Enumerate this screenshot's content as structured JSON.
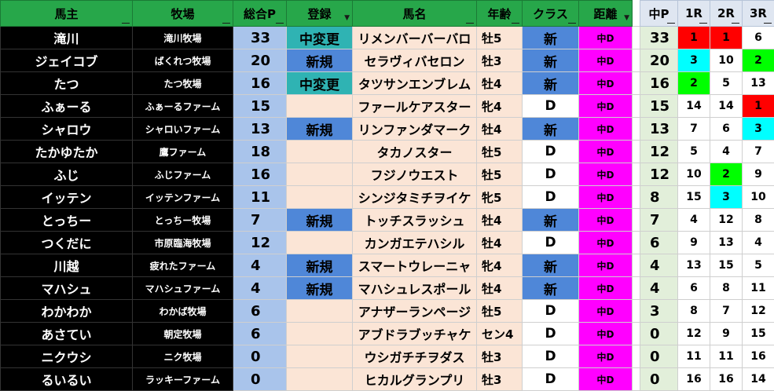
{
  "headers": {
    "owner": "馬主",
    "farm": "牧場",
    "total_points": "総合P",
    "registration": "登録",
    "horse_name": "馬名",
    "age": "年齢",
    "class": "クラス",
    "distance": "距離",
    "mid_points": "中P",
    "race1": "1R",
    "race2": "2R",
    "race3": "3R"
  },
  "filter_glyph": "▼",
  "colors": {
    "header_green": "#27a74a",
    "owner_black": "#000000",
    "total_blue": "#a9c4eb",
    "reg_teal": "#2fb3b3",
    "reg_blue": "#4f87d8",
    "peach": "#fbe5d6",
    "magenta": "#ff00ff",
    "midp_green": "#e2efda",
    "rank_red": "#ff0000",
    "rank_cyan": "#00ffff",
    "rank_green": "#00ff00"
  },
  "rows": [
    {
      "owner": "滝川",
      "farm": "滝川牧場",
      "total": "33",
      "registration": "中変更",
      "reg_type": "mid",
      "horse": "リメンバーバーバロ",
      "age": "牡5",
      "class": "新",
      "class_type": "new",
      "distance": "中D",
      "mid_p": "33",
      "r1": "1",
      "r1_color": "red",
      "r2": "1",
      "r2_color": "red",
      "r3": "6",
      "r3_color": ""
    },
    {
      "owner": "ジェイコブ",
      "farm": "ばくれつ牧場",
      "total": "20",
      "registration": "新規",
      "reg_type": "new",
      "horse": "セラヴィバセロン",
      "age": "牡3",
      "class": "新",
      "class_type": "new",
      "distance": "中D",
      "mid_p": "20",
      "r1": "3",
      "r1_color": "cyan",
      "r2": "10",
      "r2_color": "",
      "r3": "2",
      "r3_color": "green"
    },
    {
      "owner": "たつ",
      "farm": "たつ牧場",
      "total": "16",
      "registration": "中変更",
      "reg_type": "mid",
      "horse": "タツサンエンブレム",
      "age": "牡4",
      "class": "新",
      "class_type": "new",
      "distance": "中D",
      "mid_p": "16",
      "r1": "2",
      "r1_color": "green",
      "r2": "5",
      "r2_color": "",
      "r3": "13",
      "r3_color": ""
    },
    {
      "owner": "ふぁーる",
      "farm": "ふぁーるファーム",
      "total": "15",
      "registration": "",
      "reg_type": "",
      "horse": "ファールケアスター",
      "age": "牝4",
      "class": "D",
      "class_type": "",
      "distance": "中D",
      "mid_p": "15",
      "r1": "14",
      "r1_color": "",
      "r2": "14",
      "r2_color": "",
      "r3": "1",
      "r3_color": "red"
    },
    {
      "owner": "シャロウ",
      "farm": "シャロいファーム",
      "total": "13",
      "registration": "新規",
      "reg_type": "new",
      "horse": "リンファンダマーク",
      "age": "牡4",
      "class": "新",
      "class_type": "new",
      "distance": "中D",
      "mid_p": "13",
      "r1": "7",
      "r1_color": "",
      "r2": "6",
      "r2_color": "",
      "r3": "3",
      "r3_color": "cyan"
    },
    {
      "owner": "たかゆたか",
      "farm": "鷹ファーム",
      "total": "18",
      "registration": "",
      "reg_type": "",
      "horse": "タカノスター",
      "age": "牡5",
      "class": "D",
      "class_type": "",
      "distance": "中D",
      "mid_p": "12",
      "r1": "5",
      "r1_color": "",
      "r2": "4",
      "r2_color": "",
      "r3": "7",
      "r3_color": ""
    },
    {
      "owner": "ふじ",
      "farm": "ふじファーム",
      "total": "16",
      "registration": "",
      "reg_type": "",
      "horse": "フジノウエスト",
      "age": "牡5",
      "class": "D",
      "class_type": "",
      "distance": "中D",
      "mid_p": "12",
      "r1": "10",
      "r1_color": "",
      "r2": "2",
      "r2_color": "green",
      "r3": "9",
      "r3_color": ""
    },
    {
      "owner": "イッテン",
      "farm": "イッテンファーム",
      "total": "11",
      "registration": "",
      "reg_type": "",
      "horse": "シンジタミチヲイケ",
      "age": "牝5",
      "class": "D",
      "class_type": "",
      "distance": "中D",
      "mid_p": "8",
      "r1": "15",
      "r1_color": "",
      "r2": "3",
      "r2_color": "cyan",
      "r3": "10",
      "r3_color": ""
    },
    {
      "owner": "とっちー",
      "farm": "とっちー牧場",
      "total": "7",
      "registration": "新規",
      "reg_type": "new",
      "horse": "トッチスラッシュ",
      "age": "牡4",
      "class": "新",
      "class_type": "new",
      "distance": "中D",
      "mid_p": "7",
      "r1": "4",
      "r1_color": "",
      "r2": "12",
      "r2_color": "",
      "r3": "8",
      "r3_color": ""
    },
    {
      "owner": "つくだに",
      "farm": "市原臨海牧場",
      "total": "12",
      "registration": "",
      "reg_type": "",
      "horse": "カンガエテハシル",
      "age": "牡4",
      "class": "D",
      "class_type": "",
      "distance": "中D",
      "mid_p": "6",
      "r1": "9",
      "r1_color": "",
      "r2": "13",
      "r2_color": "",
      "r3": "4",
      "r3_color": ""
    },
    {
      "owner": "川越",
      "farm": "疲れたファーム",
      "total": "4",
      "registration": "新規",
      "reg_type": "new",
      "horse": "スマートウレーニャ",
      "age": "牝4",
      "class": "新",
      "class_type": "new",
      "distance": "中D",
      "mid_p": "4",
      "r1": "13",
      "r1_color": "",
      "r2": "15",
      "r2_color": "",
      "r3": "5",
      "r3_color": ""
    },
    {
      "owner": "マハシュ",
      "farm": "マハシュファーム",
      "total": "4",
      "registration": "新規",
      "reg_type": "new",
      "horse": "マハシュレスポール",
      "age": "牡4",
      "class": "新",
      "class_type": "new",
      "distance": "中D",
      "mid_p": "4",
      "r1": "6",
      "r1_color": "",
      "r2": "8",
      "r2_color": "",
      "r3": "11",
      "r3_color": ""
    },
    {
      "owner": "わかわか",
      "farm": "わかば牧場",
      "total": "6",
      "registration": "",
      "reg_type": "",
      "horse": "アナザーランページ",
      "age": "牡5",
      "class": "D",
      "class_type": "",
      "distance": "中D",
      "mid_p": "3",
      "r1": "8",
      "r1_color": "",
      "r2": "7",
      "r2_color": "",
      "r3": "12",
      "r3_color": ""
    },
    {
      "owner": "あさてい",
      "farm": "朝定牧場",
      "total": "6",
      "registration": "",
      "reg_type": "",
      "horse": "アブドラブッチャケ",
      "age": "セン4",
      "class": "D",
      "class_type": "",
      "distance": "中D",
      "mid_p": "0",
      "r1": "12",
      "r1_color": "",
      "r2": "9",
      "r2_color": "",
      "r3": "15",
      "r3_color": ""
    },
    {
      "owner": "ニクウシ",
      "farm": "ニク牧場",
      "total": "0",
      "registration": "",
      "reg_type": "",
      "horse": "ウシガチチヲダス",
      "age": "牡3",
      "class": "D",
      "class_type": "",
      "distance": "中D",
      "mid_p": "0",
      "r1": "11",
      "r1_color": "",
      "r2": "11",
      "r2_color": "",
      "r3": "16",
      "r3_color": ""
    },
    {
      "owner": "るいるい",
      "farm": "ラッキーファーム",
      "total": "0",
      "registration": "",
      "reg_type": "",
      "horse": "ヒカルグランプリ",
      "age": "牡3",
      "class": "D",
      "class_type": "",
      "distance": "中D",
      "mid_p": "0",
      "r1": "16",
      "r1_color": "",
      "r2": "16",
      "r2_color": "",
      "r3": "14",
      "r3_color": ""
    }
  ]
}
